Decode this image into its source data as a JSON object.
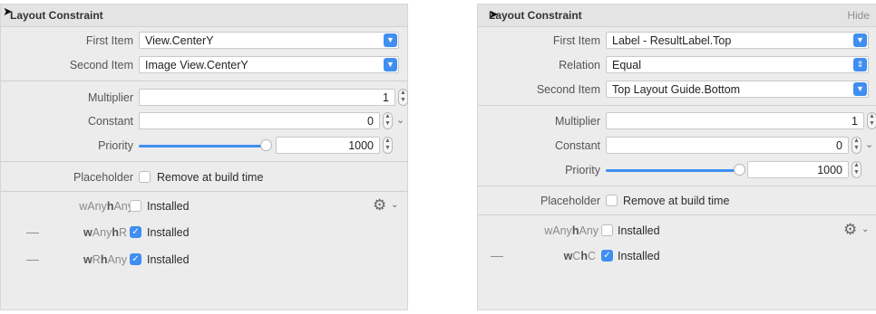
{
  "left": {
    "header_title": "Layout Constraint",
    "first_item_label": "First Item",
    "first_item_value": "View.CenterY",
    "second_item_label": "Second Item",
    "second_item_value": "Image View.CenterY",
    "multiplier_label": "Multiplier",
    "multiplier_value": "1",
    "constant_label": "Constant",
    "constant_value": "0",
    "priority_label": "Priority",
    "priority_value": "1000",
    "placeholder_label": "Placeholder",
    "placeholder_text": "Remove at build time",
    "installed_rows": [
      {
        "w": "w",
        "wclass": "Any",
        "h": "h",
        "hclass": "Any",
        "checked": false,
        "label": "Installed"
      },
      {
        "w": "w",
        "wclass": "Any",
        "h": "h",
        "hclass": "R",
        "checked": true,
        "label": "Installed"
      },
      {
        "w": "w",
        "wclass": "R",
        "h": "h",
        "hclass": "Any",
        "checked": true,
        "label": "Installed"
      }
    ]
  },
  "right": {
    "header_title": "Layout Constraint",
    "hide_label": "Hide",
    "first_item_label": "First Item",
    "first_item_value": "Label - ResultLabel.Top",
    "relation_label": "Relation",
    "relation_value": "Equal",
    "second_item_label": "Second Item",
    "second_item_value": "Top Layout Guide.Bottom",
    "multiplier_label": "Multiplier",
    "multiplier_value": "1",
    "constant_label": "Constant",
    "constant_value": "0",
    "priority_label": "Priority",
    "priority_value": "1000",
    "placeholder_label": "Placeholder",
    "placeholder_text": "Remove at build time",
    "installed_rows": [
      {
        "w": "w",
        "wclass": "Any",
        "h": "h",
        "hclass": "Any",
        "checked": false,
        "label": "Installed"
      },
      {
        "w": "w",
        "wclass": "C",
        "h": "h",
        "hclass": "C",
        "checked": true,
        "label": "Installed"
      }
    ]
  },
  "icons": {
    "popup_arrow": "chevron-down-icon",
    "stepper": "stepper-icon",
    "gear": "gear-icon",
    "checkmark": "checkmark-icon",
    "cursor": "mouse-cursor-icon"
  },
  "colors": {
    "accent": "#3f8ef1",
    "panel_bg": "#ececec"
  },
  "slider_priority_fraction": 1.0
}
